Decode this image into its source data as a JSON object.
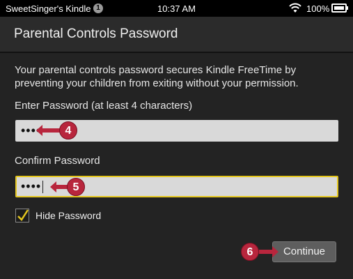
{
  "status_bar": {
    "device_name": "SweetSinger's Kindle",
    "notification_count": "1",
    "time": "10:37 AM",
    "battery_percent": "100%"
  },
  "dialog": {
    "title": "Parental Controls Password",
    "description": "Your parental controls password secures Kindle FreeTime by preventing your children from exiting without your permission.",
    "enter_label": "Enter Password (at least 4 characters)",
    "enter_value": "••••",
    "confirm_label": "Confirm Password",
    "confirm_value": "••••",
    "hide_password_label": "Hide Password",
    "hide_password_checked": true,
    "continue_label": "Continue"
  },
  "callouts": {
    "step4": "4",
    "step5": "5",
    "step6": "6"
  },
  "colors": {
    "accent_yellow": "#e4c61e",
    "callout_red": "#b8263d"
  }
}
